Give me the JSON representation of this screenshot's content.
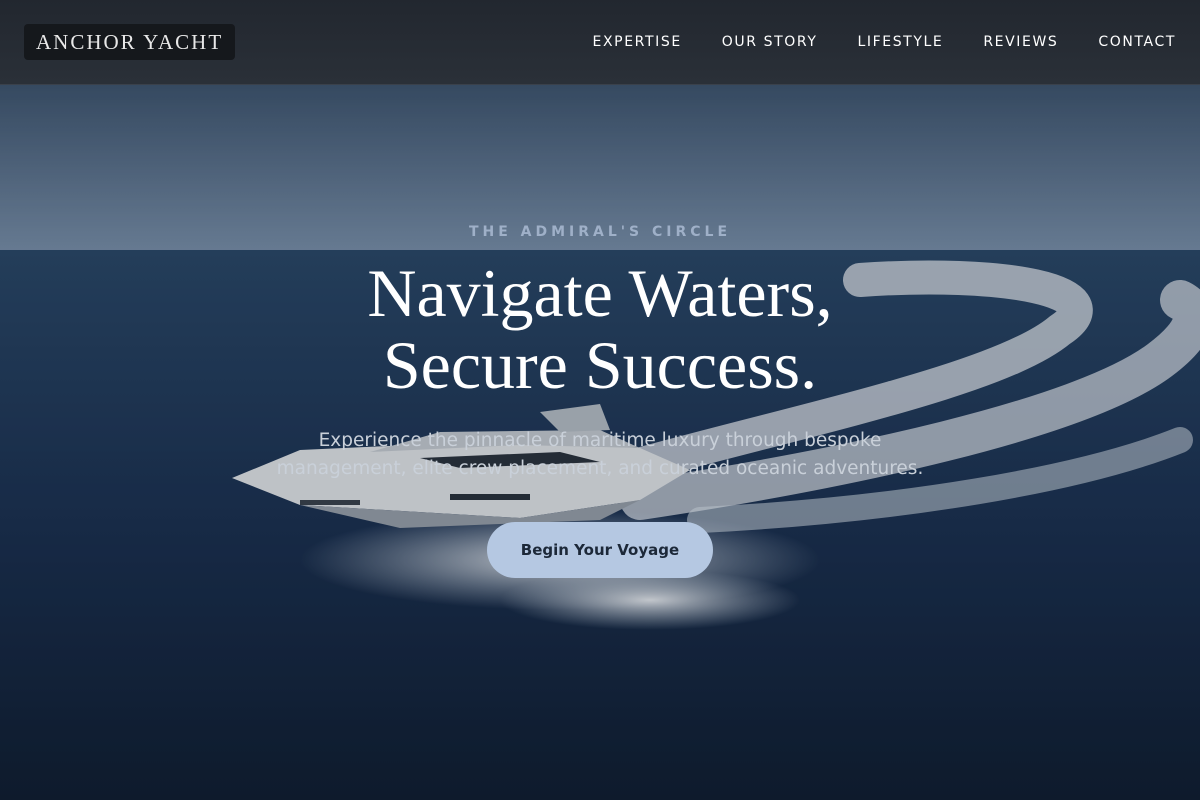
{
  "brand": {
    "name": "ANCHOR YACHT"
  },
  "nav": {
    "items": [
      {
        "label": "EXPERTISE"
      },
      {
        "label": "OUR STORY"
      },
      {
        "label": "LIFESTYLE"
      },
      {
        "label": "REVIEWS"
      },
      {
        "label": "CONTACT"
      }
    ]
  },
  "hero": {
    "eyebrow": "THE ADMIRAL'S CIRCLE",
    "headline_line1": "Navigate Waters,",
    "headline_line2": "Secure Success.",
    "subtitle": "Experience the pinnacle of maritime luxury through bespoke management, elite crew placement, and curated oceanic adventures.",
    "cta_label": "Begin Your Voyage",
    "background_alt": "yacht-at-sea-photo"
  },
  "colors": {
    "nav_bg": "#262b33",
    "cta_bg": "#b5c8e2",
    "eyebrow": "#9fb0c8",
    "sea": "#1c3350"
  }
}
